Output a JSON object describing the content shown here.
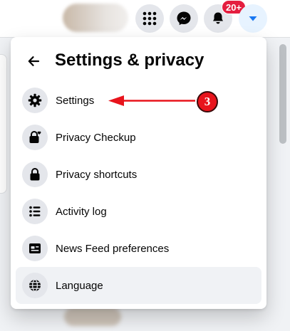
{
  "topbar": {
    "notification_badge": "20+",
    "icons": [
      "grid-menu-icon",
      "messenger-icon",
      "bell-icon",
      "caret-down-icon"
    ]
  },
  "panel": {
    "title": "Settings & privacy",
    "back_icon": "arrow-left-icon",
    "items": [
      {
        "label": "Settings",
        "icon": "gear-icon"
      },
      {
        "label": "Privacy Checkup",
        "icon": "lock-heart-icon"
      },
      {
        "label": "Privacy shortcuts",
        "icon": "lock-icon"
      },
      {
        "label": "Activity log",
        "icon": "list-icon"
      },
      {
        "label": "News Feed preferences",
        "icon": "feed-icon"
      },
      {
        "label": "Language",
        "icon": "globe-icon"
      }
    ],
    "highlighted_item": "Language"
  },
  "annotation": {
    "step_number": "3",
    "points_to": "Settings",
    "color": "#e8141c"
  },
  "colors": {
    "accent": "#1877f2",
    "badge": "#e41e3f",
    "icon_bg": "#e4e6eb",
    "hover_bg": "#f0f2f5"
  }
}
